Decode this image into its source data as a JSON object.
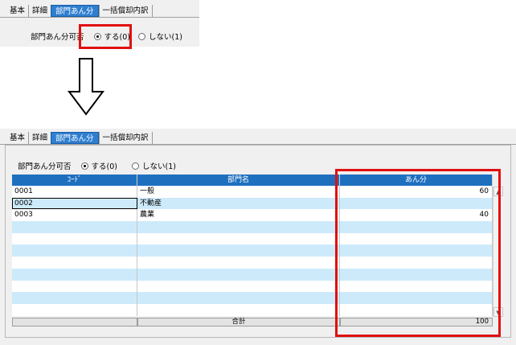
{
  "top": {
    "tabs": [
      "基本",
      "詳細",
      "部門あん分",
      "一括償却内訳"
    ],
    "active_tab": 2,
    "field_label": "部門あん分可否",
    "option_yes": "する(0)",
    "option_no": "しない(1)",
    "selected": "yes"
  },
  "bottom": {
    "tabs": [
      "基本",
      "詳細",
      "部門あん分",
      "一括償却内訳"
    ],
    "active_tab": 2,
    "field_label": "部門あん分可否",
    "option_yes": "する(0)",
    "option_no": "しない(1)",
    "selected": "yes",
    "grid": {
      "headers": [
        "ｺｰﾄﾞ",
        "部門名",
        "あん分"
      ],
      "rows": [
        {
          "code": "0001",
          "name": "一般",
          "amount": "60"
        },
        {
          "code": "0002",
          "name": "不動産",
          "amount": ""
        },
        {
          "code": "0003",
          "name": "農業",
          "amount": "40"
        },
        {
          "code": "",
          "name": "",
          "amount": ""
        },
        {
          "code": "",
          "name": "",
          "amount": ""
        },
        {
          "code": "",
          "name": "",
          "amount": ""
        },
        {
          "code": "",
          "name": "",
          "amount": ""
        },
        {
          "code": "",
          "name": "",
          "amount": ""
        },
        {
          "code": "",
          "name": "",
          "amount": ""
        },
        {
          "code": "",
          "name": "",
          "amount": ""
        },
        {
          "code": "",
          "name": "",
          "amount": ""
        }
      ],
      "footer_label": "合計",
      "footer_total": "100"
    }
  },
  "colors": {
    "tab_active": "#2f7fd0",
    "grid_header": "#1f6fbf",
    "row_alt": "#cdeafb",
    "highlight": "#e01010"
  },
  "icons": {
    "arrow": "down-arrow-icon",
    "scroll_up": "scroll-up-icon",
    "scroll_down": "scroll-down-icon"
  }
}
